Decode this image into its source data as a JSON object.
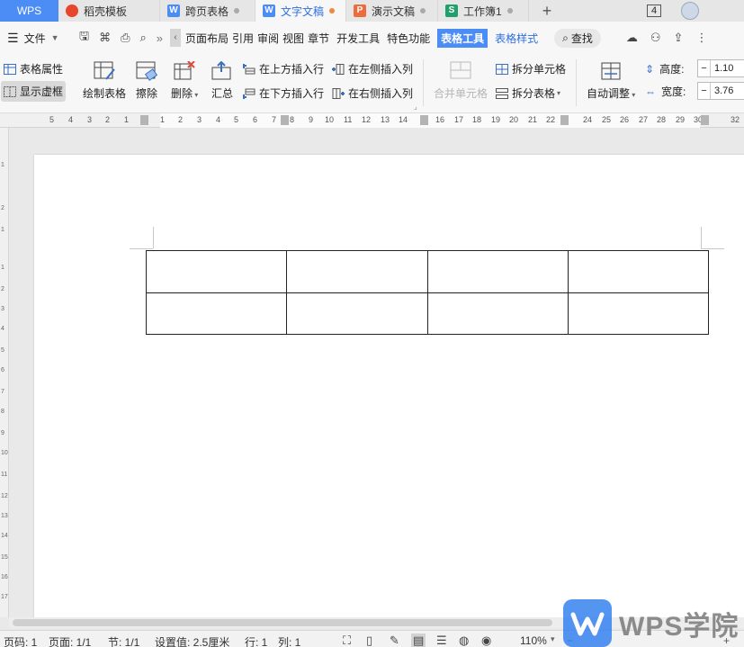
{
  "tabs": [
    {
      "label": "WPS"
    },
    {
      "label": "稻壳模板",
      "icon": "docer-icon",
      "color": "#e8452c"
    },
    {
      "label": "跨页表格",
      "icon": "writer-icon",
      "color": "#4b8cf5"
    },
    {
      "label": "文字文稿",
      "icon": "writer-icon",
      "color": "#4b8cf5"
    },
    {
      "label": "演示文稿",
      "icon": "presentation-icon",
      "color": "#f06b3c"
    },
    {
      "label": "工作簿1",
      "icon": "spreadsheet-icon",
      "color": "#22a06b"
    }
  ],
  "tab_icon_letters": {
    "writer": "W",
    "presentation": "P",
    "spreadsheet": "S",
    "docer": "稻"
  },
  "window": {
    "badge": "4"
  },
  "menu": {
    "file": "文件",
    "tabs": [
      "页面布局",
      "引用",
      "审阅",
      "视图",
      "章节",
      "开发工具",
      "特色功能",
      "表格工具",
      "表格样式"
    ],
    "active_tab": "表格工具",
    "search": "查找"
  },
  "ribbon": {
    "table_props": "表格属性",
    "show_gridlines": "显示虚框",
    "draw_table": "绘制表格",
    "erase": "擦除",
    "delete": "删除",
    "summary": "汇总",
    "insert_row_above": "在上方插入行",
    "insert_row_below": "在下方插入行",
    "insert_col_left": "在左侧插入列",
    "insert_col_right": "在右侧插入列",
    "merge_cells": "合并单元格",
    "split_cells": "拆分单元格",
    "split_table": "拆分表格",
    "auto_fit": "自动调整",
    "height_label": "高度:",
    "height_value": "1.10",
    "width_label": "宽度:",
    "width_value": "3.76"
  },
  "ruler": {
    "left_numbers": [
      "5",
      "4",
      "3",
      "2",
      "1"
    ],
    "right_numbers": [
      "1",
      "2",
      "3",
      "4",
      "5",
      "6",
      "7",
      "8",
      "9",
      "10",
      "11",
      "12",
      "13",
      "14",
      "15",
      "16",
      "17",
      "18",
      "19",
      "20",
      "21",
      "22",
      "23",
      "24",
      "25",
      "26",
      "27",
      "28",
      "29",
      "30",
      "31",
      "32"
    ],
    "vertical_numbers": [
      "1",
      "2",
      "1",
      "1",
      "2",
      "3",
      "4",
      "5",
      "6",
      "7",
      "8",
      "9",
      "10",
      "11",
      "12",
      "13",
      "14",
      "15",
      "16",
      "17",
      "18"
    ]
  },
  "document": {
    "table": {
      "rows": 2,
      "cols": 4
    }
  },
  "statusbar": {
    "page_code": "页码: 1",
    "page": "页面: 1/1",
    "section": "节: 1/1",
    "setting": "设置值: 2.5厘米",
    "row": "行: 1",
    "col": "列: 1",
    "zoom": "110%"
  },
  "watermark": {
    "text": "WPS学院"
  }
}
